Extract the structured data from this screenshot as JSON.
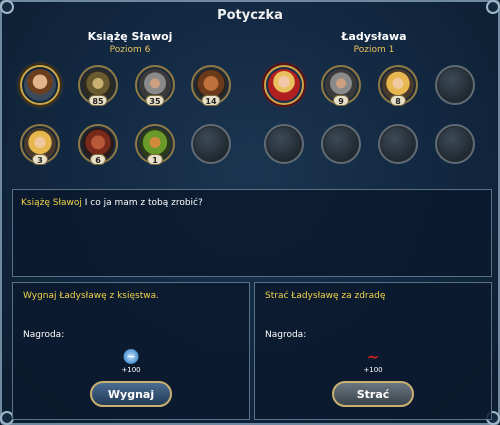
{
  "window": {
    "title": "Potyczka"
  },
  "left_side": {
    "name": "Książę Sławoj",
    "level": "Poziom 6",
    "slots": [
      {
        "portrait": "prince",
        "count": ""
      },
      {
        "portrait": "knight",
        "count": "85"
      },
      {
        "portrait": "soldier",
        "count": "35"
      },
      {
        "portrait": "ogre",
        "count": "14"
      },
      {
        "portrait": "blonde",
        "count": "3"
      },
      {
        "portrait": "demon",
        "count": "6"
      },
      {
        "portrait": "dryad",
        "count": "1"
      },
      {
        "portrait": "empty",
        "count": ""
      }
    ]
  },
  "right_side": {
    "name": "Ładysława",
    "level": "Poziom 1",
    "slots": [
      {
        "portrait": "lady-red",
        "count": ""
      },
      {
        "portrait": "soldier",
        "count": "9"
      },
      {
        "portrait": "blonde",
        "count": "8"
      },
      {
        "portrait": "empty",
        "count": ""
      },
      {
        "portrait": "empty",
        "count": ""
      },
      {
        "portrait": "empty",
        "count": ""
      },
      {
        "portrait": "empty",
        "count": ""
      },
      {
        "portrait": "empty",
        "count": ""
      }
    ]
  },
  "dialog": {
    "speaker": "Książę Sławoj",
    "text": "I co ja mam z tobą zrobić?"
  },
  "options": [
    {
      "title": "Wygnaj Ładysławę z księstwa.",
      "reward_label": "Nagroda:",
      "reward_icon": "blue-swirl-icon",
      "reward_value": "+100",
      "button": "Wygnaj"
    },
    {
      "title": "Strać Ładysławę za zdradę",
      "reward_label": "Nagroda:",
      "reward_icon": "red-swirl-icon",
      "reward_value": "+100",
      "button": "Strać"
    }
  ],
  "colors": {
    "accent_gold": "#f2d44a",
    "background": "#122740",
    "border": "#5a7288"
  }
}
